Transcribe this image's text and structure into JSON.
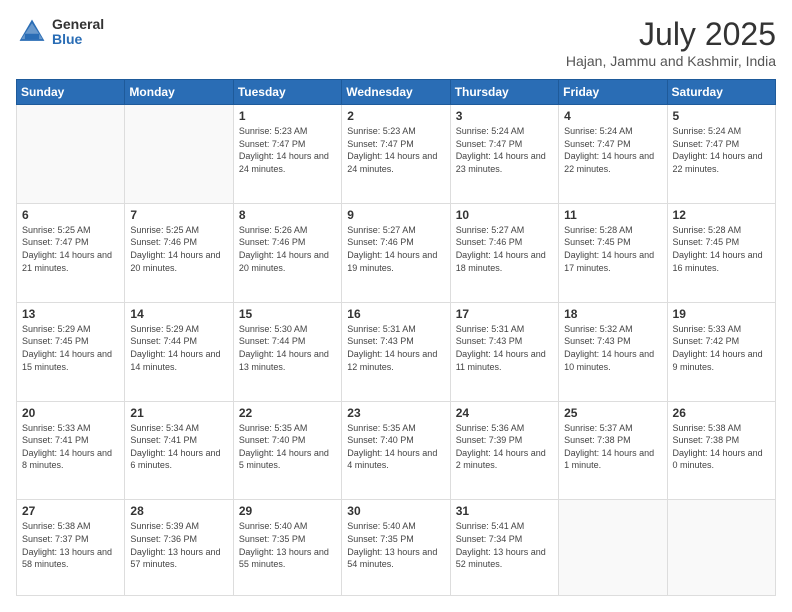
{
  "logo": {
    "general": "General",
    "blue": "Blue"
  },
  "header": {
    "title": "July 2025",
    "subtitle": "Hajan, Jammu and Kashmir, India"
  },
  "weekdays": [
    "Sunday",
    "Monday",
    "Tuesday",
    "Wednesday",
    "Thursday",
    "Friday",
    "Saturday"
  ],
  "weeks": [
    [
      {
        "day": "",
        "info": ""
      },
      {
        "day": "",
        "info": ""
      },
      {
        "day": "1",
        "info": "Sunrise: 5:23 AM\nSunset: 7:47 PM\nDaylight: 14 hours and 24 minutes."
      },
      {
        "day": "2",
        "info": "Sunrise: 5:23 AM\nSunset: 7:47 PM\nDaylight: 14 hours and 24 minutes."
      },
      {
        "day": "3",
        "info": "Sunrise: 5:24 AM\nSunset: 7:47 PM\nDaylight: 14 hours and 23 minutes."
      },
      {
        "day": "4",
        "info": "Sunrise: 5:24 AM\nSunset: 7:47 PM\nDaylight: 14 hours and 22 minutes."
      },
      {
        "day": "5",
        "info": "Sunrise: 5:24 AM\nSunset: 7:47 PM\nDaylight: 14 hours and 22 minutes."
      }
    ],
    [
      {
        "day": "6",
        "info": "Sunrise: 5:25 AM\nSunset: 7:47 PM\nDaylight: 14 hours and 21 minutes."
      },
      {
        "day": "7",
        "info": "Sunrise: 5:25 AM\nSunset: 7:46 PM\nDaylight: 14 hours and 20 minutes."
      },
      {
        "day": "8",
        "info": "Sunrise: 5:26 AM\nSunset: 7:46 PM\nDaylight: 14 hours and 20 minutes."
      },
      {
        "day": "9",
        "info": "Sunrise: 5:27 AM\nSunset: 7:46 PM\nDaylight: 14 hours and 19 minutes."
      },
      {
        "day": "10",
        "info": "Sunrise: 5:27 AM\nSunset: 7:46 PM\nDaylight: 14 hours and 18 minutes."
      },
      {
        "day": "11",
        "info": "Sunrise: 5:28 AM\nSunset: 7:45 PM\nDaylight: 14 hours and 17 minutes."
      },
      {
        "day": "12",
        "info": "Sunrise: 5:28 AM\nSunset: 7:45 PM\nDaylight: 14 hours and 16 minutes."
      }
    ],
    [
      {
        "day": "13",
        "info": "Sunrise: 5:29 AM\nSunset: 7:45 PM\nDaylight: 14 hours and 15 minutes."
      },
      {
        "day": "14",
        "info": "Sunrise: 5:29 AM\nSunset: 7:44 PM\nDaylight: 14 hours and 14 minutes."
      },
      {
        "day": "15",
        "info": "Sunrise: 5:30 AM\nSunset: 7:44 PM\nDaylight: 14 hours and 13 minutes."
      },
      {
        "day": "16",
        "info": "Sunrise: 5:31 AM\nSunset: 7:43 PM\nDaylight: 14 hours and 12 minutes."
      },
      {
        "day": "17",
        "info": "Sunrise: 5:31 AM\nSunset: 7:43 PM\nDaylight: 14 hours and 11 minutes."
      },
      {
        "day": "18",
        "info": "Sunrise: 5:32 AM\nSunset: 7:43 PM\nDaylight: 14 hours and 10 minutes."
      },
      {
        "day": "19",
        "info": "Sunrise: 5:33 AM\nSunset: 7:42 PM\nDaylight: 14 hours and 9 minutes."
      }
    ],
    [
      {
        "day": "20",
        "info": "Sunrise: 5:33 AM\nSunset: 7:41 PM\nDaylight: 14 hours and 8 minutes."
      },
      {
        "day": "21",
        "info": "Sunrise: 5:34 AM\nSunset: 7:41 PM\nDaylight: 14 hours and 6 minutes."
      },
      {
        "day": "22",
        "info": "Sunrise: 5:35 AM\nSunset: 7:40 PM\nDaylight: 14 hours and 5 minutes."
      },
      {
        "day": "23",
        "info": "Sunrise: 5:35 AM\nSunset: 7:40 PM\nDaylight: 14 hours and 4 minutes."
      },
      {
        "day": "24",
        "info": "Sunrise: 5:36 AM\nSunset: 7:39 PM\nDaylight: 14 hours and 2 minutes."
      },
      {
        "day": "25",
        "info": "Sunrise: 5:37 AM\nSunset: 7:38 PM\nDaylight: 14 hours and 1 minute."
      },
      {
        "day": "26",
        "info": "Sunrise: 5:38 AM\nSunset: 7:38 PM\nDaylight: 14 hours and 0 minutes."
      }
    ],
    [
      {
        "day": "27",
        "info": "Sunrise: 5:38 AM\nSunset: 7:37 PM\nDaylight: 13 hours and 58 minutes."
      },
      {
        "day": "28",
        "info": "Sunrise: 5:39 AM\nSunset: 7:36 PM\nDaylight: 13 hours and 57 minutes."
      },
      {
        "day": "29",
        "info": "Sunrise: 5:40 AM\nSunset: 7:35 PM\nDaylight: 13 hours and 55 minutes."
      },
      {
        "day": "30",
        "info": "Sunrise: 5:40 AM\nSunset: 7:35 PM\nDaylight: 13 hours and 54 minutes."
      },
      {
        "day": "31",
        "info": "Sunrise: 5:41 AM\nSunset: 7:34 PM\nDaylight: 13 hours and 52 minutes."
      },
      {
        "day": "",
        "info": ""
      },
      {
        "day": "",
        "info": ""
      }
    ]
  ]
}
